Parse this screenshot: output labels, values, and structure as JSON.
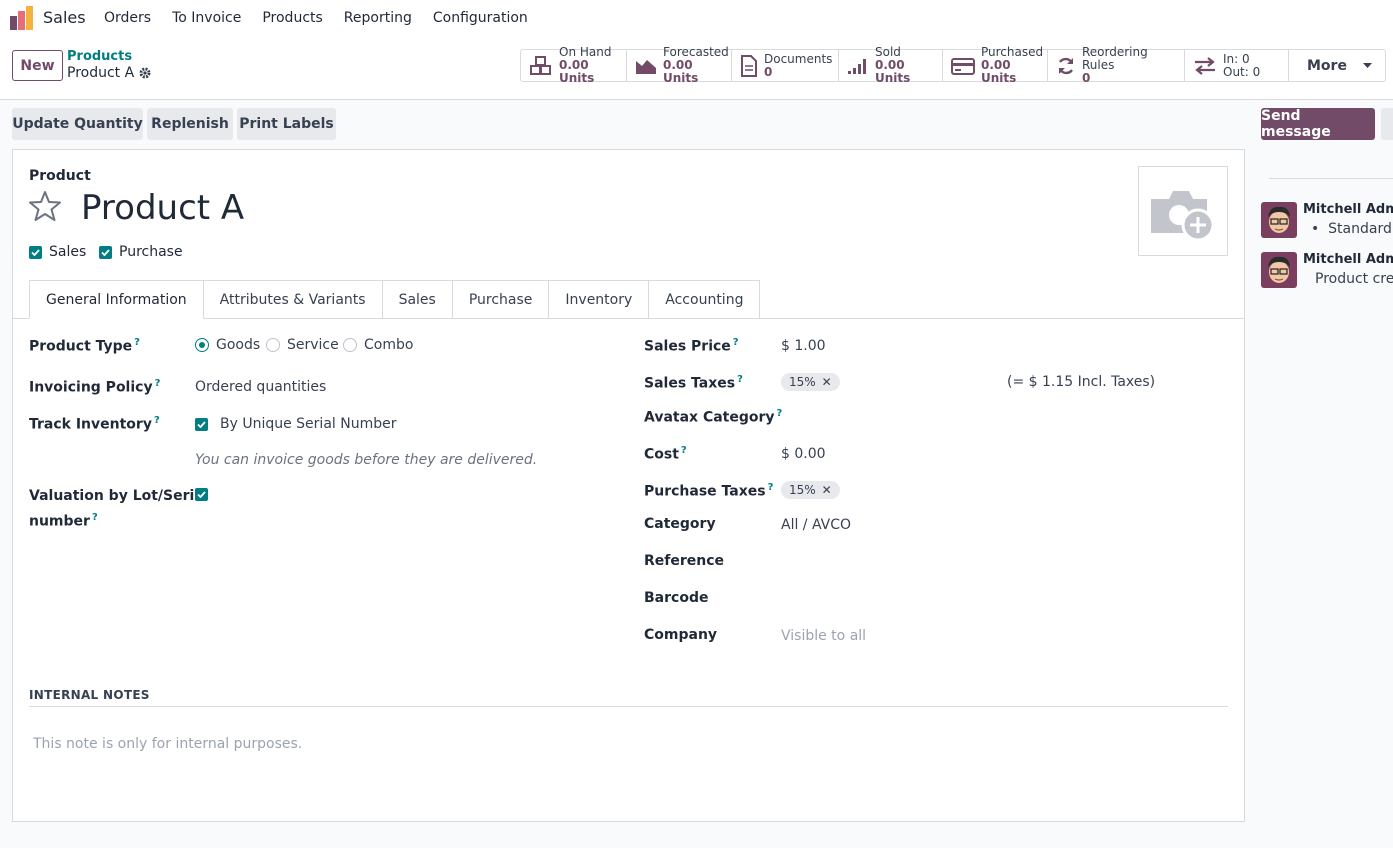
{
  "navbar": {
    "app_name": "Sales",
    "menu": [
      "Orders",
      "To Invoice",
      "Products",
      "Reporting",
      "Configuration"
    ]
  },
  "control": {
    "new_label": "New",
    "breadcrumb_parent": "Products",
    "breadcrumb_current": "Product A"
  },
  "stats": [
    {
      "label": "On Hand",
      "value": "0.00 Units",
      "icon": "cubes-icon"
    },
    {
      "label": "Forecasted",
      "value": "0.00 Units",
      "icon": "area-chart-icon"
    },
    {
      "label": "Documents",
      "value": "0",
      "icon": "document-icon"
    },
    {
      "label": "Sold",
      "value": "0.00 Units",
      "icon": "signal-icon"
    },
    {
      "label": "Purchased",
      "value": "0.00 Units",
      "icon": "credit-card-icon"
    },
    {
      "label": "Reordering Rules",
      "value": "0",
      "icon": "refresh-icon"
    },
    {
      "label": "In: 0",
      "value": "Out: 0",
      "icon": "exchange-icon"
    }
  ],
  "stats_more": "More",
  "actions": {
    "update_quantity": "Update Quantity",
    "replenish": "Replenish",
    "print_labels": "Print Labels",
    "send_message": "Send message"
  },
  "form": {
    "product_label": "Product",
    "product_name": "Product A",
    "sales_checkbox": "Sales",
    "purchase_checkbox": "Purchase",
    "tabs": [
      "General Information",
      "Attributes & Variants",
      "Sales",
      "Purchase",
      "Inventory",
      "Accounting"
    ],
    "left": {
      "product_type_label": "Product Type",
      "product_type_options": [
        "Goods",
        "Service",
        "Combo"
      ],
      "product_type_selected": "Goods",
      "invoicing_policy_label": "Invoicing Policy",
      "invoicing_policy_value": "Ordered quantities",
      "track_inventory_label": "Track Inventory",
      "track_inventory_value": "By Unique Serial Number",
      "track_hint": "You can invoice goods before they are delivered.",
      "valuation_label_1": "Valuation by Lot/Serial",
      "valuation_label_2": "number"
    },
    "right": {
      "sales_price_label": "Sales Price",
      "sales_price_value": "$ 1.00",
      "sales_taxes_label": "Sales Taxes",
      "sales_taxes_tag": "15%",
      "sales_taxes_incl": "(= $ 1.15 Incl. Taxes)",
      "avatax_label": "Avatax Category",
      "cost_label": "Cost",
      "cost_value": "$ 0.00",
      "purchase_taxes_label": "Purchase Taxes",
      "purchase_taxes_tag": "15%",
      "category_label": "Category",
      "category_value": "All / AVCO",
      "reference_label": "Reference",
      "barcode_label": "Barcode",
      "company_label": "Company",
      "company_placeholder": "Visible to all"
    },
    "internal_notes_label": "INTERNAL NOTES",
    "internal_notes_placeholder": "This note is only for internal purposes."
  },
  "chatter": [
    {
      "author": "Mitchell Admin",
      "body": "Standard",
      "bullet": true
    },
    {
      "author": "Mitchell Admin",
      "body": "Product crea",
      "bullet": false
    }
  ],
  "colors": {
    "brand": "#714b67",
    "accent": "#017e84"
  }
}
